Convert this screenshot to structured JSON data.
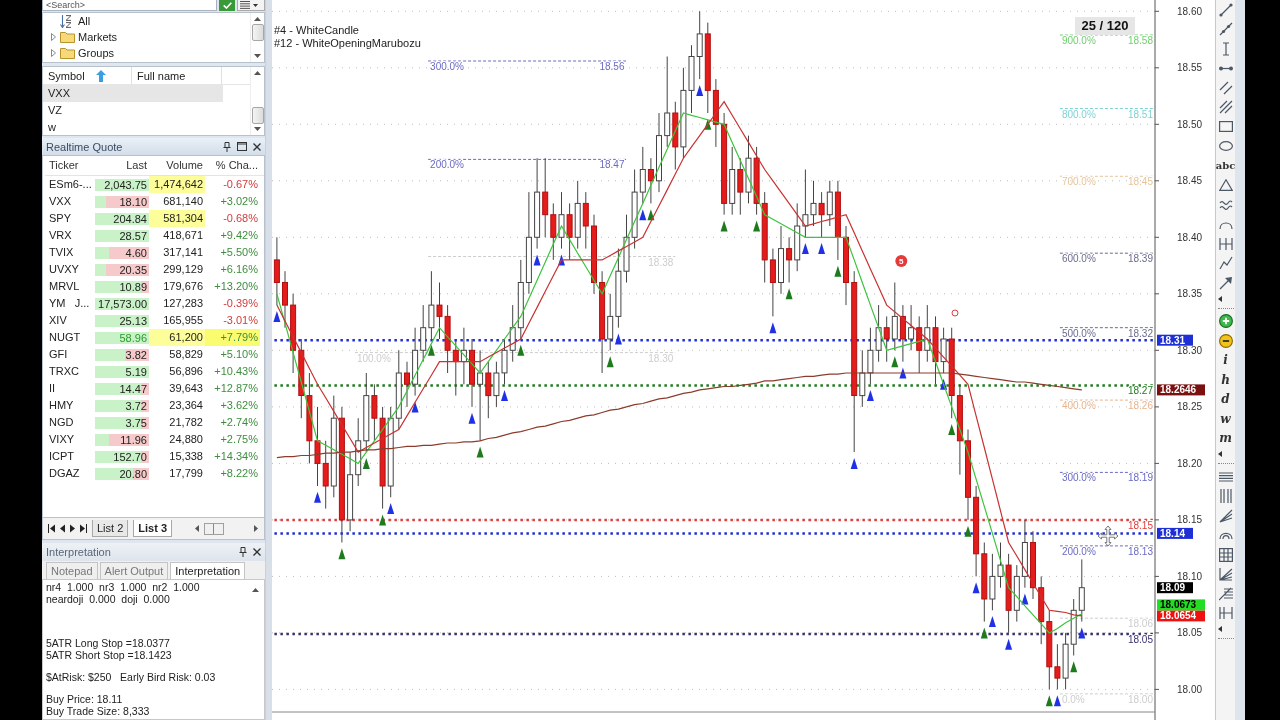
{
  "search": {
    "placeholder": "<Search>"
  },
  "tree": {
    "items": [
      {
        "kind": "sort",
        "label": "All"
      },
      {
        "kind": "folder",
        "label": "Markets",
        "expanded": false
      },
      {
        "kind": "folder",
        "label": "Groups",
        "expanded": false
      }
    ]
  },
  "symbols": {
    "columns": [
      "Symbol",
      "Full name"
    ],
    "rows": [
      {
        "symbol": "VXX",
        "selected": true
      },
      {
        "symbol": "VZ",
        "selected": false
      },
      {
        "symbol": "w",
        "selected": false
      }
    ]
  },
  "quote_panel": {
    "title": "Realtime Quote",
    "columns": [
      "Ticker",
      "Last",
      "Volume",
      "% Cha..."
    ],
    "rows": [
      {
        "ticker": "ESm6-...",
        "last": "2,043.75",
        "volume": "1,474,642",
        "change": "-0.67%",
        "negative": true,
        "level": 1,
        "last_highlight": false,
        "volume_highlight": true,
        "change_highlight": false
      },
      {
        "ticker": "VXX",
        "last": "18.10",
        "volume": "681,140",
        "change": "+3.02%",
        "negative": false,
        "level": 0.2,
        "last_highlight": false,
        "volume_highlight": false,
        "change_highlight": false
      },
      {
        "ticker": "SPY",
        "last": "204.84",
        "volume": "581,304",
        "change": "-0.68%",
        "negative": true,
        "level": 1,
        "last_highlight": false,
        "volume_highlight": true,
        "change_highlight": false
      },
      {
        "ticker": "VRX",
        "last": "28.57",
        "volume": "418,671",
        "change": "+9.42%",
        "negative": false,
        "level": 1,
        "last_highlight": false,
        "volume_highlight": false,
        "change_highlight": false
      },
      {
        "ticker": "TVIX",
        "last": "4.60",
        "volume": "317,141",
        "change": "+5.50%",
        "negative": false,
        "level": 0.25,
        "last_highlight": false,
        "volume_highlight": false,
        "change_highlight": false
      },
      {
        "ticker": "UVXY",
        "last": "20.35",
        "volume": "299,129",
        "change": "+6.16%",
        "negative": false,
        "level": 0.2,
        "last_highlight": false,
        "volume_highlight": false,
        "change_highlight": false
      },
      {
        "ticker": "MRVL",
        "last": "10.89",
        "volume": "179,676",
        "change": "+13.20%",
        "negative": false,
        "level": 0.85,
        "last_highlight": false,
        "volume_highlight": false,
        "change_highlight": false
      },
      {
        "ticker": "YM   J...",
        "last": "17,573.00",
        "volume": "127,283",
        "change": "-0.39%",
        "negative": true,
        "level": 1,
        "last_highlight": false,
        "volume_highlight": false,
        "change_highlight": false
      },
      {
        "ticker": "XIV",
        "last": "25.13",
        "volume": "165,955",
        "change": "-3.01%",
        "negative": true,
        "level": 1,
        "last_highlight": false,
        "volume_highlight": false,
        "change_highlight": false
      },
      {
        "ticker": "NUGT",
        "last": "58.96",
        "volume": "61,200",
        "change": "+7.79%",
        "negative": false,
        "level": 1,
        "last_highlight": true,
        "volume_highlight": true,
        "change_highlight": true
      },
      {
        "ticker": "GFI",
        "last": "3.82",
        "volume": "58,829",
        "change": "+5.10%",
        "negative": false,
        "level": 0.55,
        "last_highlight": false,
        "volume_highlight": false,
        "change_highlight": false
      },
      {
        "ticker": "TRXC",
        "last": "5.19",
        "volume": "56,896",
        "change": "+10.43%",
        "negative": false,
        "level": 1,
        "last_highlight": false,
        "volume_highlight": false,
        "change_highlight": false
      },
      {
        "ticker": "II",
        "last": "14.47",
        "volume": "39,643",
        "change": "+12.87%",
        "negative": false,
        "level": 0.85,
        "last_highlight": false,
        "volume_highlight": false,
        "change_highlight": false
      },
      {
        "ticker": "HMY",
        "last": "3.72",
        "volume": "23,364",
        "change": "+3.62%",
        "negative": false,
        "level": 0.85,
        "last_highlight": false,
        "volume_highlight": false,
        "change_highlight": false
      },
      {
        "ticker": "NGD",
        "last": "3.75",
        "volume": "21,782",
        "change": "+2.74%",
        "negative": false,
        "level": 0.85,
        "last_highlight": false,
        "volume_highlight": false,
        "change_highlight": false
      },
      {
        "ticker": "VIXY",
        "last": "11.96",
        "volume": "24,880",
        "change": "+2.75%",
        "negative": false,
        "level": 0.25,
        "last_highlight": false,
        "volume_highlight": false,
        "change_highlight": false
      },
      {
        "ticker": "ICPT",
        "last": "152.70",
        "volume": "15,338",
        "change": "+14.34%",
        "negative": false,
        "level": 0.85,
        "last_highlight": false,
        "volume_highlight": false,
        "change_highlight": false
      },
      {
        "ticker": "DGAZ",
        "last": "20.80",
        "volume": "17,799",
        "change": "+8.22%",
        "negative": false,
        "level": 0.7,
        "last_highlight": false,
        "volume_highlight": false,
        "change_highlight": false
      }
    ]
  },
  "list_tabs": [
    {
      "label": "List 2",
      "selected": false
    },
    {
      "label": "List 3",
      "selected": true
    }
  ],
  "interpretation": {
    "title": "Interpretation",
    "tabs": [
      {
        "label": "Notepad",
        "selected": false
      },
      {
        "label": "Alert Output",
        "selected": false
      },
      {
        "label": "Interpretation",
        "selected": true
      }
    ],
    "blocks": [
      [
        "nr4  1.000  nr3  1.000  nr2  1.000",
        "neardoji  0.000  doji  0.000"
      ],
      [
        "5ATR Long Stop =18.0377",
        "5ATR Short Stop =18.1423"
      ],
      [
        "$AtRisk: $250   Early Bird Risk: 0.03"
      ],
      [
        "Buy Price: 18.11",
        "Buy Trade Size: 8,333"
      ]
    ]
  },
  "chart": {
    "legend": [
      "#4 - WhiteCandle",
      "#12 - WhiteOpeningMarubozu"
    ],
    "counter": "25 / 120",
    "price_tags": [
      {
        "text": "18.2646",
        "color": "#7a1010"
      },
      {
        "text": "18.09",
        "color": "#000000"
      },
      {
        "text": "18.0673",
        "color": "#22dd22"
      },
      {
        "text": "18.0654",
        "color": "#ee1111"
      }
    ],
    "chart_data": [
      {
        "type": "candlestick",
        "ylim": [
          17.98,
          18.61
        ],
        "grid": "y",
        "categories": [
          null,
          null,
          null,
          null,
          null,
          null,
          null,
          null,
          null,
          null,
          null,
          null,
          null,
          null,
          null,
          null,
          null,
          null,
          null,
          null,
          null,
          null,
          null,
          null,
          null,
          null,
          null,
          null,
          null,
          null,
          null,
          null,
          null,
          null,
          null,
          null,
          null,
          null,
          null,
          null,
          null,
          null,
          null,
          null,
          null,
          null,
          null,
          null,
          null,
          null,
          null,
          null,
          null,
          null,
          null,
          null,
          null,
          null,
          null,
          null,
          null,
          null,
          null,
          null,
          null,
          null,
          null,
          null,
          null,
          null,
          null,
          null,
          null,
          null,
          null,
          null,
          null,
          null,
          null,
          null,
          null,
          null,
          null,
          null,
          null,
          null,
          null,
          null,
          null,
          null,
          null,
          null,
          null,
          null,
          null,
          null,
          null,
          null,
          null,
          null
        ],
        "yticks": [
          {
            "value": 18.6,
            "label": "18.60"
          },
          {
            "value": 18.55,
            "label": "18.55"
          },
          {
            "value": 18.5,
            "label": "18.50"
          },
          {
            "value": 18.45,
            "label": "18.45"
          },
          {
            "value": 18.4,
            "label": "18.40"
          },
          {
            "value": 18.35,
            "label": "18.35"
          },
          {
            "value": 18.3,
            "label": "18.30"
          },
          {
            "value": 18.25,
            "label": "18.25"
          },
          {
            "value": 18.2,
            "label": "18.20"
          },
          {
            "value": 18.15,
            "label": "18.15"
          },
          {
            "value": 18.1,
            "label": "18.10"
          },
          {
            "value": 18.05,
            "label": "18.05"
          },
          {
            "value": 18.0,
            "label": "18.00"
          }
        ],
        "ohlc": [
          [
            18.38,
            18.4,
            18.34,
            18.36
          ],
          [
            18.36,
            18.37,
            18.32,
            18.34
          ],
          [
            18.34,
            18.35,
            18.28,
            18.3
          ],
          [
            18.3,
            18.31,
            18.24,
            18.26
          ],
          [
            18.26,
            18.28,
            18.2,
            18.22
          ],
          [
            18.22,
            18.25,
            18.18,
            18.2
          ],
          [
            18.2,
            18.22,
            18.16,
            18.18
          ],
          [
            18.18,
            18.26,
            18.17,
            18.24
          ],
          [
            18.24,
            18.25,
            18.13,
            18.15
          ],
          [
            18.15,
            18.21,
            18.14,
            18.19
          ],
          [
            18.19,
            18.24,
            18.18,
            18.22
          ],
          [
            18.22,
            18.28,
            18.21,
            18.26
          ],
          [
            18.26,
            18.27,
            18.22,
            18.24
          ],
          [
            18.24,
            18.25,
            18.16,
            18.18
          ],
          [
            18.18,
            18.25,
            18.17,
            18.24
          ],
          [
            18.24,
            18.3,
            18.23,
            18.28
          ],
          [
            18.28,
            18.29,
            18.25,
            18.27
          ],
          [
            18.27,
            18.32,
            18.26,
            18.3
          ],
          [
            18.3,
            18.34,
            18.29,
            18.32
          ],
          [
            18.32,
            18.37,
            18.31,
            18.34
          ],
          [
            18.34,
            18.36,
            18.31,
            18.33
          ],
          [
            18.33,
            18.34,
            18.28,
            18.3
          ],
          [
            18.3,
            18.31,
            18.26,
            18.29
          ],
          [
            18.29,
            18.32,
            18.27,
            18.3
          ],
          [
            18.3,
            18.31,
            18.25,
            18.27
          ],
          [
            18.27,
            18.3,
            18.22,
            18.28
          ],
          [
            18.28,
            18.29,
            18.24,
            18.26
          ],
          [
            18.26,
            18.29,
            18.25,
            18.28
          ],
          [
            18.28,
            18.31,
            18.27,
            18.3
          ],
          [
            18.3,
            18.34,
            18.29,
            18.32
          ],
          [
            18.32,
            18.38,
            18.31,
            18.36
          ],
          [
            18.36,
            18.44,
            18.35,
            18.4
          ],
          [
            18.4,
            18.47,
            18.39,
            18.44
          ],
          [
            18.44,
            18.47,
            18.4,
            18.42
          ],
          [
            18.42,
            18.43,
            18.38,
            18.4
          ],
          [
            18.4,
            18.44,
            18.39,
            18.42
          ],
          [
            18.42,
            18.43,
            18.38,
            18.4
          ],
          [
            18.4,
            18.45,
            18.39,
            18.43
          ],
          [
            18.43,
            18.44,
            18.39,
            18.41
          ],
          [
            18.41,
            18.42,
            18.35,
            18.36
          ],
          [
            18.36,
            18.37,
            18.28,
            18.31
          ],
          [
            18.31,
            18.35,
            18.3,
            18.33
          ],
          [
            18.33,
            18.39,
            18.32,
            18.37
          ],
          [
            18.37,
            18.42,
            18.36,
            18.4
          ],
          [
            18.4,
            18.46,
            18.39,
            18.44
          ],
          [
            18.44,
            18.48,
            18.43,
            18.46
          ],
          [
            18.46,
            18.47,
            18.43,
            18.45
          ],
          [
            18.45,
            18.51,
            18.44,
            18.49
          ],
          [
            18.49,
            18.56,
            18.48,
            18.51
          ],
          [
            18.51,
            18.52,
            18.46,
            18.48
          ],
          [
            18.48,
            18.55,
            18.47,
            18.53
          ],
          [
            18.53,
            18.57,
            18.51,
            18.56
          ],
          [
            18.56,
            18.6,
            18.54,
            18.58
          ],
          [
            18.58,
            18.59,
            18.51,
            18.53
          ],
          [
            18.53,
            18.54,
            18.48,
            18.5
          ],
          [
            18.5,
            18.51,
            18.42,
            18.43
          ],
          [
            18.43,
            18.48,
            18.42,
            18.46
          ],
          [
            18.46,
            18.47,
            18.42,
            18.44
          ],
          [
            18.44,
            18.49,
            18.43,
            18.47
          ],
          [
            18.47,
            18.48,
            18.42,
            18.43
          ],
          [
            18.43,
            18.44,
            18.36,
            18.38
          ],
          [
            18.38,
            18.39,
            18.33,
            18.36
          ],
          [
            18.36,
            18.41,
            18.35,
            18.39
          ],
          [
            18.39,
            18.4,
            18.36,
            18.38
          ],
          [
            18.38,
            18.43,
            18.37,
            18.41
          ],
          [
            18.41,
            18.46,
            18.4,
            18.42
          ],
          [
            18.42,
            18.45,
            18.41,
            18.43
          ],
          [
            18.43,
            18.44,
            18.4,
            18.42
          ],
          [
            18.42,
            18.45,
            18.41,
            18.44
          ],
          [
            18.44,
            18.45,
            18.38,
            18.4
          ],
          [
            18.4,
            18.41,
            18.34,
            18.36
          ],
          [
            18.36,
            18.37,
            18.21,
            18.26
          ],
          [
            18.26,
            18.3,
            18.25,
            18.28
          ],
          [
            18.28,
            18.32,
            18.27,
            18.3
          ],
          [
            18.3,
            18.34,
            18.29,
            18.32
          ],
          [
            18.32,
            18.33,
            18.29,
            18.31
          ],
          [
            18.31,
            18.36,
            18.3,
            18.33
          ],
          [
            18.33,
            18.34,
            18.29,
            18.31
          ],
          [
            18.31,
            18.34,
            18.3,
            18.32
          ],
          [
            18.32,
            18.33,
            18.28,
            18.3
          ],
          [
            18.3,
            18.34,
            18.29,
            18.32
          ],
          [
            18.32,
            18.33,
            18.27,
            18.29
          ],
          [
            18.29,
            18.32,
            18.28,
            18.31
          ],
          [
            18.31,
            18.32,
            18.24,
            18.26
          ],
          [
            18.26,
            18.27,
            18.19,
            18.22
          ],
          [
            18.22,
            18.23,
            18.15,
            18.17
          ],
          [
            18.17,
            18.18,
            18.1,
            18.12
          ],
          [
            18.12,
            18.13,
            18.06,
            18.08
          ],
          [
            18.08,
            18.12,
            18.07,
            18.1
          ],
          [
            18.1,
            18.13,
            18.09,
            18.11
          ],
          [
            18.11,
            18.12,
            18.05,
            18.07
          ],
          [
            18.07,
            18.11,
            18.06,
            18.1
          ],
          [
            18.1,
            18.15,
            18.09,
            18.13
          ],
          [
            18.13,
            18.14,
            18.08,
            18.09
          ],
          [
            18.09,
            18.1,
            18.04,
            18.06
          ],
          [
            18.06,
            18.07,
            18.0,
            18.02
          ],
          [
            18.02,
            18.04,
            18.0,
            18.01
          ],
          [
            18.01,
            18.05,
            18.0,
            18.04
          ],
          [
            18.04,
            18.08,
            18.03,
            18.07
          ],
          [
            18.07,
            18.115,
            18.06,
            18.09
          ]
        ],
        "series": [
          {
            "type": "line",
            "color": "#3cc43c",
            "values": [
              18.35,
              18.324,
              18.298,
              18.272,
              18.246,
              18.22,
              18.216,
              18.212,
              18.208,
              18.204,
              18.2,
              18.21,
              18.22,
              18.23,
              18.24,
              18.25,
              18.264,
              18.278,
              18.292,
              18.306,
              18.32,
              18.312,
              18.304,
              18.296,
              18.288,
              18.28,
              18.29,
              18.3,
              18.31,
              18.32,
              18.33,
              18.346,
              18.362,
              18.378,
              18.394,
              18.41,
              18.398,
              18.386,
              18.374,
              18.362,
              18.35,
              18.366,
              18.382,
              18.398,
              18.414,
              18.43,
              18.446,
              18.462,
              18.478,
              18.494,
              18.51,
              18.508,
              18.506,
              18.504,
              18.502,
              18.5,
              18.484,
              18.468,
              18.452,
              18.436,
              18.42,
              18.416,
              18.412,
              18.408,
              18.404,
              18.4,
              18.4,
              18.4,
              18.4,
              18.4,
              18.4,
              18.38,
              18.36,
              18.34,
              18.32,
              18.3,
              18.302,
              18.304,
              18.306,
              18.308,
              18.31,
              18.29,
              18.27,
              18.25,
              18.23,
              18.21,
              18.186,
              18.162,
              18.138,
              18.114,
              18.09,
              18.082,
              18.074,
              18.066,
              18.058,
              18.05,
              18.054,
              18.059,
              18.063,
              18.067
            ]
          },
          {
            "type": "line",
            "color": "#c83232",
            "values": [
              18.34,
              18.326,
              18.312,
              18.298,
              18.284,
              18.27,
              18.258,
              18.246,
              18.234,
              18.222,
              18.21,
              18.214,
              18.218,
              18.222,
              18.226,
              18.23,
              18.242,
              18.254,
              18.266,
              18.278,
              18.29,
              18.29,
              18.29,
              18.29,
              18.29,
              18.29,
              18.294,
              18.298,
              18.302,
              18.306,
              18.31,
              18.324,
              18.338,
              18.352,
              18.366,
              18.38,
              18.38,
              18.38,
              18.38,
              18.38,
              18.38,
              18.384,
              18.388,
              18.392,
              18.396,
              18.4,
              18.414,
              18.428,
              18.442,
              18.456,
              18.47,
              18.48,
              18.49,
              18.5,
              18.51,
              18.52,
              18.508,
              18.496,
              18.484,
              18.472,
              18.46,
              18.45,
              18.44,
              18.43,
              18.42,
              18.41,
              18.412,
              18.414,
              18.416,
              18.418,
              18.42,
              18.404,
              18.388,
              18.372,
              18.356,
              18.34,
              18.334,
              18.328,
              18.322,
              18.316,
              18.31,
              18.302,
              18.294,
              18.286,
              18.278,
              18.27,
              18.242,
              18.214,
              18.186,
              18.158,
              18.13,
              18.118,
              18.106,
              18.094,
              18.082,
              18.07,
              18.069,
              18.068,
              18.066,
              18.065
            ]
          },
          {
            "type": "line",
            "color": "#8c3c2c",
            "values": [
              18.205,
              18.206,
              18.206,
              18.207,
              18.207,
              18.208,
              18.209,
              18.209,
              18.21,
              18.21,
              18.211,
              18.212,
              18.212,
              18.213,
              18.213,
              18.214,
              18.215,
              18.215,
              18.216,
              18.216,
              18.217,
              18.218,
              18.218,
              18.219,
              18.219,
              18.22,
              18.222,
              18.223,
              18.225,
              18.227,
              18.228,
              18.23,
              18.232,
              18.233,
              18.235,
              18.237,
              18.238,
              18.24,
              18.242,
              18.243,
              18.245,
              18.247,
              18.248,
              18.25,
              18.252,
              18.253,
              18.255,
              18.257,
              18.258,
              18.26,
              18.262,
              18.263,
              18.265,
              18.266,
              18.267,
              18.268,
              18.268,
              18.269,
              18.27,
              18.271,
              18.273,
              18.273,
              18.274,
              18.275,
              18.276,
              18.277,
              18.277,
              18.278,
              18.279,
              18.279,
              18.28,
              18.28,
              18.28,
              18.28,
              18.28,
              18.28,
              18.28,
              18.28,
              18.28,
              18.28,
              18.28,
              18.28,
              18.28,
              18.28,
              18.279,
              18.278,
              18.277,
              18.276,
              18.275,
              18.274,
              18.273,
              18.272,
              18.272,
              18.271,
              18.27,
              18.269,
              18.268,
              18.267,
              18.266,
              18.265
            ]
          },
          {
            "type": "scatter",
            "marker": "triangle",
            "color": "#1f30e6",
            "values": [
              18.33,
              null,
              null,
              null,
              null,
              18.17,
              null,
              null,
              null,
              null,
              null,
              null,
              null,
              null,
              18.16,
              null,
              null,
              18.25,
              null,
              null,
              null,
              null,
              null,
              null,
              18.24,
              null,
              null,
              null,
              18.26,
              null,
              null,
              null,
              18.38,
              null,
              null,
              18.38,
              null,
              null,
              null,
              null,
              null,
              null,
              18.31,
              null,
              null,
              18.42,
              null,
              null,
              null,
              null,
              null,
              null,
              18.53,
              null,
              null,
              null,
              null,
              null,
              null,
              null,
              null,
              18.32,
              null,
              null,
              null,
              18.39,
              null,
              18.39,
              null,
              null,
              null,
              18.2,
              null,
              18.26,
              null,
              null,
              null,
              18.28,
              null,
              null,
              null,
              null,
              18.27,
              null,
              null,
              null,
              18.09,
              null,
              18.06,
              null,
              18.04,
              null,
              18.08,
              null,
              null,
              null,
              17.99,
              null,
              null,
              18.05
            ]
          },
          {
            "type": "scatter",
            "marker": "triangle",
            "color": "#1d7a1d",
            "values": [
              null,
              null,
              null,
              null,
              null,
              null,
              null,
              null,
              18.12,
              null,
              null,
              18.2,
              null,
              18.15,
              null,
              null,
              null,
              null,
              null,
              18.3,
              null,
              null,
              null,
              null,
              null,
              18.21,
              null,
              null,
              null,
              null,
              18.3,
              null,
              null,
              null,
              null,
              null,
              null,
              null,
              null,
              null,
              null,
              18.29,
              null,
              null,
              null,
              null,
              18.42,
              null,
              null,
              null,
              null,
              null,
              null,
              18.5,
              null,
              18.41,
              null,
              null,
              null,
              18.41,
              null,
              null,
              null,
              18.35,
              null,
              null,
              null,
              null,
              null,
              18.37,
              null,
              null,
              null,
              null,
              null,
              null,
              18.29,
              null,
              null,
              null,
              null,
              null,
              null,
              18.23,
              null,
              18.14,
              null,
              18.05,
              null,
              null,
              null,
              null,
              null,
              null,
              null,
              17.99,
              null,
              null,
              18.02,
              null
            ]
          }
        ],
        "ref_lines": [
          {
            "axis": "y",
            "value": 18.309,
            "label": "18.31",
            "color": "#1f2fd8",
            "line_style": "dotted"
          },
          {
            "axis": "y",
            "value": 18.269,
            "label": "18.27",
            "color": "#1e7a1e",
            "line_style": "dotted"
          },
          {
            "axis": "y",
            "value": 18.15,
            "label": "18.15",
            "color": "#e03a3a",
            "line_style": "dotted"
          },
          {
            "axis": "y",
            "value": 18.138,
            "label": "18.14",
            "color": "#1f2fd8",
            "line_style": "dotted"
          },
          {
            "axis": "y",
            "value": 18.049,
            "label": "18.05",
            "color": "#3a2f6e",
            "line_style": "dotted"
          },
          {
            "axis": "y",
            "value": 18.556,
            "label": "18.56",
            "color": "#6a6ac4",
            "line_style": "dashed"
          },
          {
            "axis": "y",
            "value": 18.469,
            "label": "18.47",
            "color": "#6a6ac4",
            "line_style": "dashed"
          },
          {
            "axis": "y",
            "value": 18.383,
            "label": "18.38",
            "color": "#cdcdcd",
            "line_style": "dashed"
          },
          {
            "axis": "y",
            "value": 18.298,
            "label": "18.30",
            "color": "#cdcdcd",
            "line_style": "dashed"
          },
          {
            "axis": "y",
            "value": 18.579,
            "label": "18.58",
            "color": "#6fcf6f",
            "line_style": "dashed"
          },
          {
            "axis": "y",
            "value": 18.514,
            "label": "18.51",
            "color": "#7fd3d3",
            "line_style": "dashed"
          },
          {
            "axis": "y",
            "value": 18.454,
            "label": "18.45",
            "color": "#e6c49c",
            "line_style": "dashed"
          },
          {
            "axis": "y",
            "value": 18.386,
            "label": "18.39",
            "color": "#6b6b8f",
            "line_style": "dashed"
          },
          {
            "axis": "y",
            "value": 18.32,
            "label": "18.32",
            "color": "#6b6b8f",
            "line_style": "dashed"
          },
          {
            "axis": "y",
            "value": 18.256,
            "label": "18.26",
            "color": "#e6b48e",
            "line_style": "dashed"
          },
          {
            "axis": "y",
            "value": 18.192,
            "label": "18.19",
            "color": "#6a6ac4",
            "line_style": "dashed"
          },
          {
            "axis": "y",
            "value": 18.127,
            "label": "18.13",
            "color": "#6a6ac4",
            "line_style": "dashed"
          },
          {
            "axis": "y",
            "value": 18.063,
            "label": "18.06",
            "color": "#cdcdcd",
            "line_style": "dashed"
          },
          {
            "axis": "y",
            "value": 17.996,
            "label": "18.00",
            "color": "#cdcdcd",
            "line_style": "dashed"
          }
        ],
        "annotations": [
          "5",
          "300.0%",
          "200.0%",
          "100.0%",
          "900.0%",
          "800.0%",
          "700.0%",
          "600.0%",
          "500.0%",
          "400.0%",
          "300.0%",
          "200.0%",
          "0.0%"
        ]
      }
    ]
  },
  "drawing_toolbar": {
    "text_tool": "abc",
    "periods": [
      "i",
      "h",
      "d",
      "w",
      "m"
    ]
  }
}
